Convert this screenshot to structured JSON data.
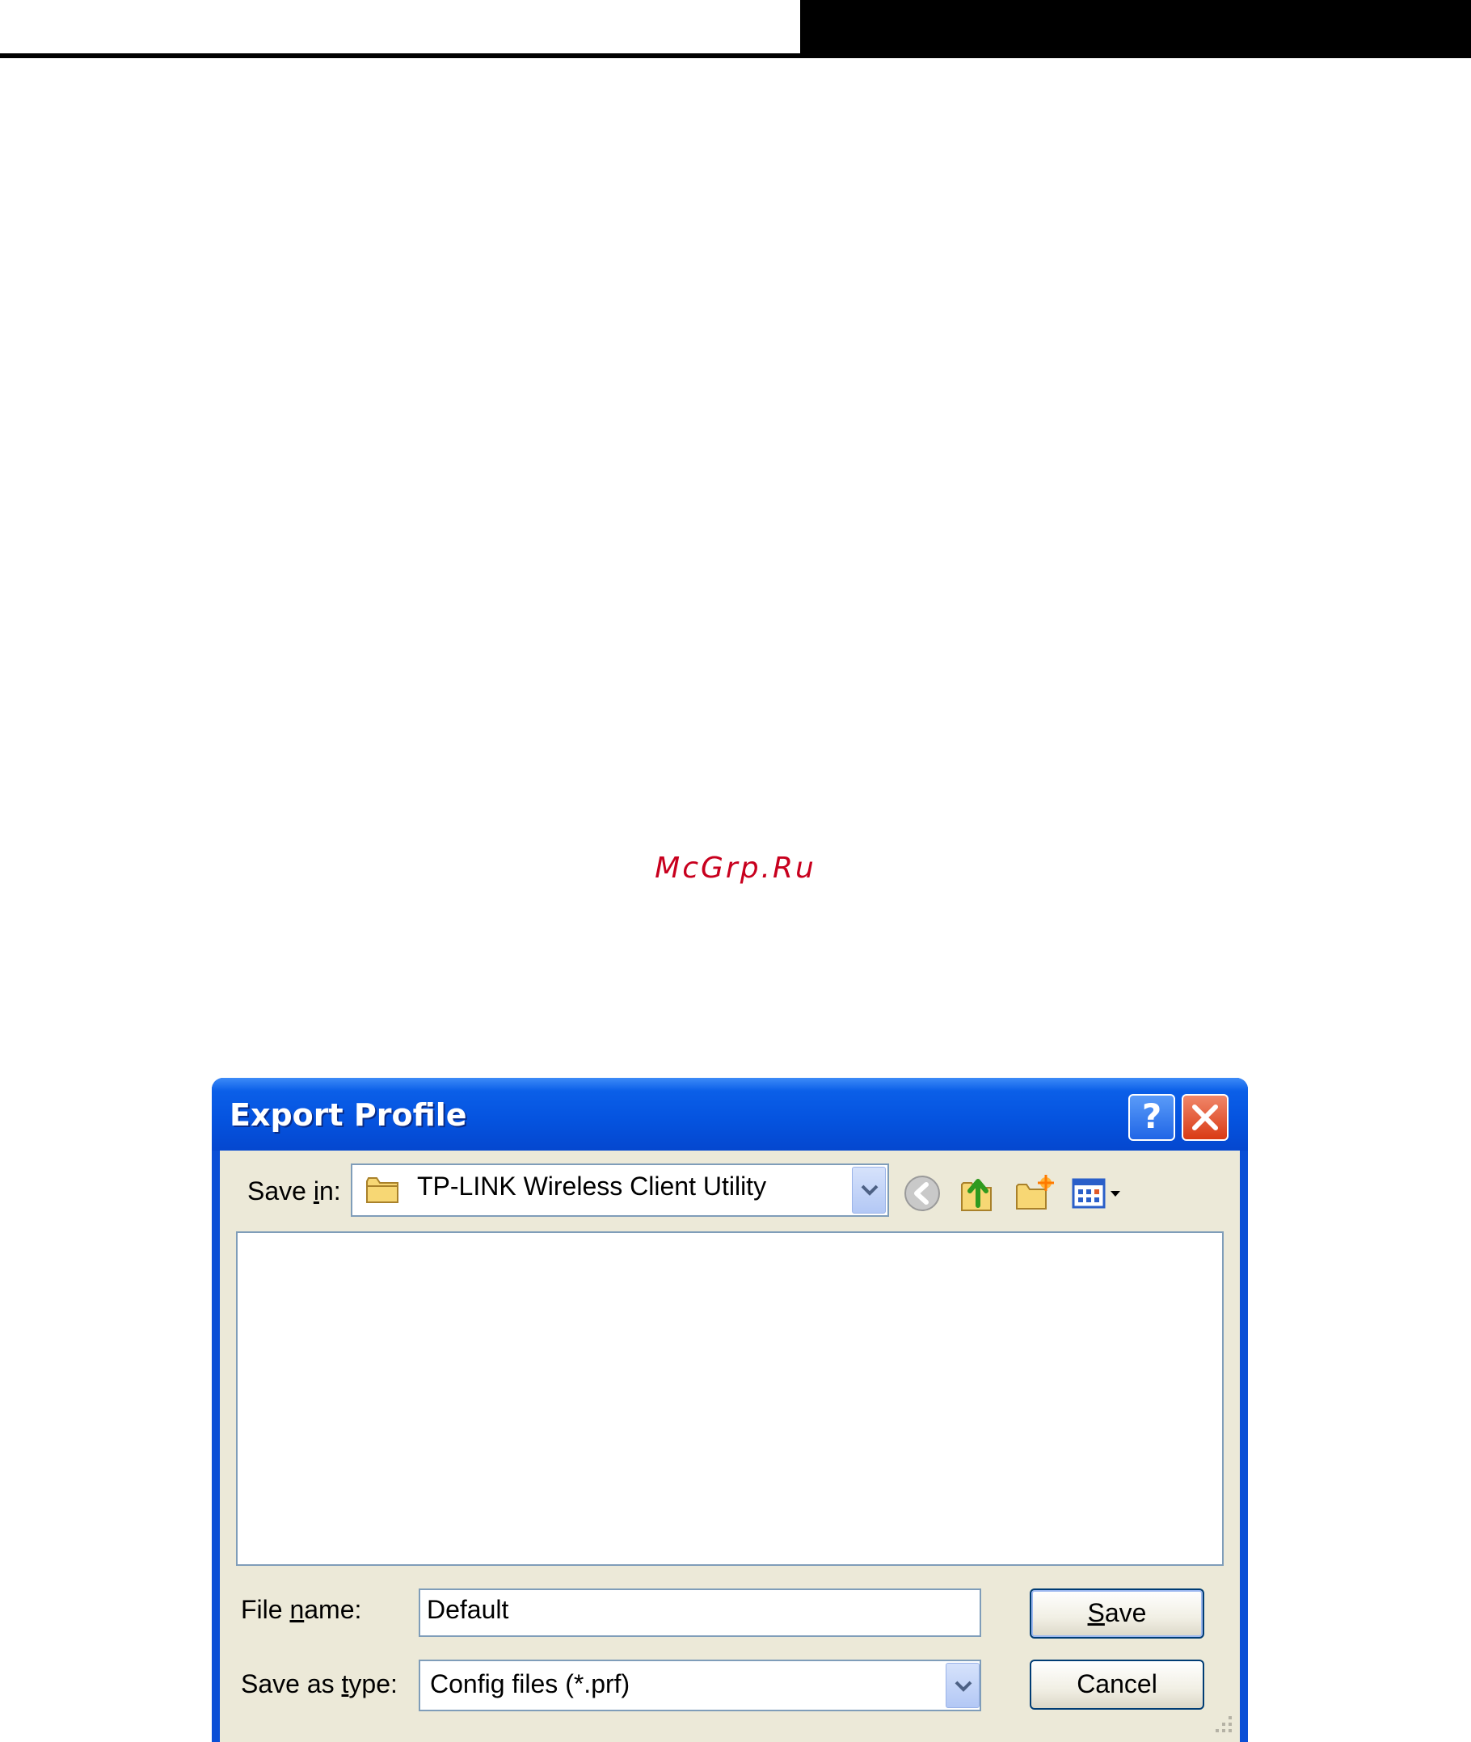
{
  "watermark": "McGrp.Ru",
  "dialog": {
    "title": "Export Profile",
    "help_label": "?",
    "close_label": "✕",
    "save_in": {
      "label_pre": "Save ",
      "label_ul": "i",
      "label_post": "n:",
      "value": "TP-LINK Wireless Client Utility"
    },
    "toolbar": {
      "icons": [
        "back-icon",
        "up-folder-icon",
        "new-folder-icon",
        "view-menu-icon"
      ]
    },
    "file_name": {
      "label_pre": "File ",
      "label_ul": "n",
      "label_post": "ame:",
      "value": "Default"
    },
    "save_as_type": {
      "label_pre": "Save as ",
      "label_ul": "t",
      "label_post": "ype:",
      "value": "Config files (*.prf)"
    },
    "save_button": {
      "ul": "S",
      "rest": "ave"
    },
    "cancel_button": "Cancel"
  }
}
